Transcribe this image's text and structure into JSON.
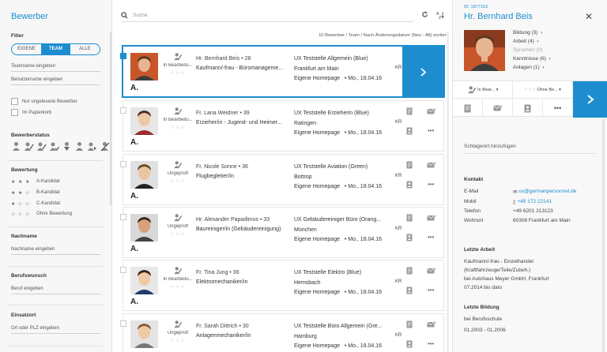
{
  "sidebar": {
    "title": "Bewerber",
    "filter_label": "Filter",
    "seg": [
      "EIGENE",
      "TEAM",
      "ALLE"
    ],
    "teamname_placeholder": "Teamname eingeben",
    "benutzername_placeholder": "Benutzername eingeben",
    "chk_unread": "Nur ungelesene Bewerber",
    "chk_trash": "Im Papierkorb",
    "status_label": "Bewerberstatus",
    "rating_label": "Bewertung",
    "ratings": [
      {
        "stars": "★ ★ ★",
        "label": "A-Kandidat"
      },
      {
        "stars": "★ ★ ☆",
        "label": "B-Kandidat"
      },
      {
        "stars": "★ ☆ ☆",
        "label": "C-Kandidat"
      },
      {
        "stars": "☆ ☆ ☆",
        "label": "Ohne Bewertung"
      }
    ],
    "nachname_label": "Nachname",
    "nachname_placeholder": "Nachname eingeben",
    "beruf_label": "Berufswunsch",
    "beruf_placeholder": "Beruf eingeben",
    "einsatz_label": "Einsatzort",
    "einsatz_placeholder": "Ort oder PLZ eingeben"
  },
  "main": {
    "search_placeholder": "Suche",
    "summary": "10 Bewerber / Team / Nach Änderungsdatum (Neu - Alt) sortiert",
    "cards": [
      {
        "status": "In Bearbeitu...",
        "stars": "☆☆☆",
        "name": "Hr. Bernhard Beis • 28",
        "job": "Kaufmann/-frau - Büromanageme...",
        "company": "UX Teststelle Allgemein (Blue)",
        "city": "Frankfurt am Main",
        "source": "Eigene Homepage",
        "date": "•  Mo., 18.04.16",
        "kr": "KR",
        "selected": true
      },
      {
        "status": "In Bearbeitu...",
        "stars": "☆☆☆",
        "name": "Fr. Lana Weidner • 39",
        "job": "Erzieher/in - Jugend- und Heimer...",
        "company": "UX Teststelle Erzieherin (Blue)",
        "city": "Ratingen",
        "source": "Eigene Homepage",
        "date": "•  Mo., 18.04.16",
        "kr": "KR",
        "selected": false
      },
      {
        "status": "Ungeprüft",
        "stars": "☆☆☆",
        "name": "Fr. Nicole Sonne • 36",
        "job": "Flugbegleiter/in",
        "company": "UX Teststelle Aviation (Green)",
        "city": "Bottrop",
        "source": "Eigene Homepage",
        "date": "•  Mo., 18.04.16",
        "kr": "KR",
        "selected": false
      },
      {
        "status": "Ungeprüft",
        "stars": "☆☆☆",
        "name": "Hr. Alexander Papadimos • 33",
        "job": "Baureiniger/in (Gebäudereinigung)",
        "company": "UX Gebäudereiniger Büro (Orang...",
        "city": "München",
        "source": "Eigene Homepage",
        "date": "•  Mo., 18.04.16",
        "kr": "KR",
        "selected": false
      },
      {
        "status": "In Bearbeitu...",
        "stars": "☆☆☆",
        "name": "Fr. Tina Jung • 36",
        "job": "Elektromechaniker/in",
        "company": "UX Teststelle Elektro (Blue)",
        "city": "Hemsbach",
        "source": "Eigene Homepage",
        "date": "•  Mo., 18.04.16",
        "kr": "KR",
        "selected": false
      },
      {
        "status": "Ungeprüft",
        "stars": "☆☆☆",
        "name": "Fr. Sarah Dittrich • 30",
        "job": "Anlagenmechaniker/in",
        "company": "UX Teststelle Büro Allgemein (Gre...",
        "city": "Hamburg",
        "source": "Eigene Homepage",
        "date": "•  Mo., 18.04.16",
        "kr": "KR",
        "selected": false
      }
    ]
  },
  "detail": {
    "id": "ID: 1877153",
    "name": "Hr. Bernhard Beis",
    "close": "✕",
    "links": [
      "Bildung (3)",
      "Arbeit (4)",
      "Sprachen (0)",
      "Kenntnisse (6)",
      "Anlagen (1)"
    ],
    "status": "In Bear...",
    "rating": "Ohne Be...",
    "schlagwort_placeholder": "Schlagwort hinzufügen",
    "kontakt_label": "Kontakt",
    "contact": [
      {
        "k": "E-Mail",
        "v": "ux@germanpersonnel.de"
      },
      {
        "k": "Mobil",
        "v": "+49 172 22141"
      },
      {
        "k": "Telefon",
        "v": "+49 6201 213123"
      },
      {
        "k": "Wohnort",
        "v": "60308 Frankfurt am Main"
      }
    ],
    "arbeit_label": "Letzte Arbeit",
    "arbeit_lines": [
      "Kaufmann/-frau - Einzelhandel",
      "(Kraftfahrzeuge/Teile/Zubeh.)",
      "bei Autohaus Meyer GmbH, Frankfurt",
      "07.2014 bis dato"
    ],
    "bildung_label": "Letzte Bildung",
    "bildung_lines": [
      "bei Berufsschule",
      "01.2003 - 01.2006"
    ]
  },
  "colors": {
    "accent": "#1d8dd0"
  }
}
